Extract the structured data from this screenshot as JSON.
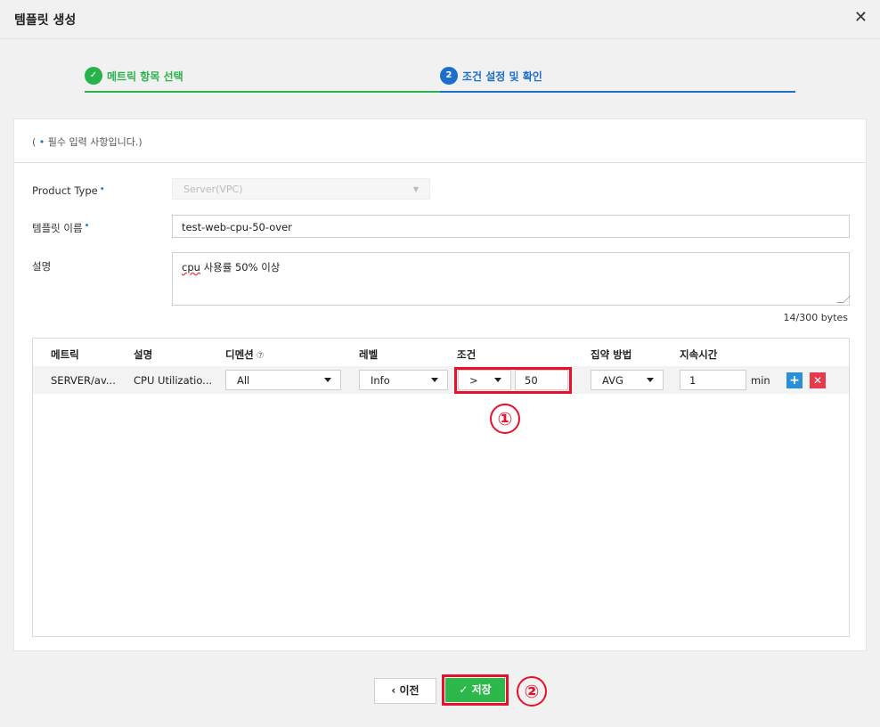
{
  "header": {
    "title": "템플릿 생성",
    "close_glyph": "✕"
  },
  "stepper": {
    "steps": [
      {
        "number": "✓",
        "label": "메트릭 항목 선택",
        "status": "completed",
        "color": "#28b34a"
      },
      {
        "number": "2",
        "label": "조건 설정 및 확인",
        "status": "active",
        "color": "#1b6fcb"
      }
    ]
  },
  "form": {
    "required_note_prefix": "( ",
    "required_note_dot": "•",
    "required_note_text": " 필수 입력 사항입니다.)",
    "product_type_label": "Product Type",
    "product_type_value": "Server(VPC)",
    "template_name_label": "템플릿 이름",
    "template_name_value": "test-web-cpu-50-over",
    "description_label": "설명",
    "description_value_underlined": "cpu",
    "description_value_rest": " 사용률 50% 이상",
    "byte_counter": "14/300 bytes",
    "required_mark": "•"
  },
  "table": {
    "headers": {
      "metric": "메트릭",
      "description": "설명",
      "dimension": "디멘션",
      "dimension_help": "⑦",
      "level": "레벨",
      "condition": "조건",
      "aggregation": "집약 방법",
      "duration": "지속시간"
    },
    "row": {
      "metric": "SERVER/av...",
      "description": "CPU Utilizatio...",
      "dimension": "All",
      "level": "Info",
      "operator": ">",
      "threshold": "50",
      "aggregation": "AVG",
      "duration": "1",
      "duration_unit": "min",
      "add_glyph": "+",
      "delete_glyph": "✕"
    }
  },
  "annotations": {
    "marker1": "①",
    "marker2": "②"
  },
  "footer": {
    "prev_glyph": "‹",
    "prev_label": "이전",
    "save_glyph": "✓",
    "save_label": "저장"
  },
  "colors": {
    "success": "#28b34a",
    "primary": "#1b6fcb",
    "highlight": "#e8112d",
    "save": "#2db84c",
    "add": "#2a8ed8",
    "delete": "#e8394a"
  }
}
